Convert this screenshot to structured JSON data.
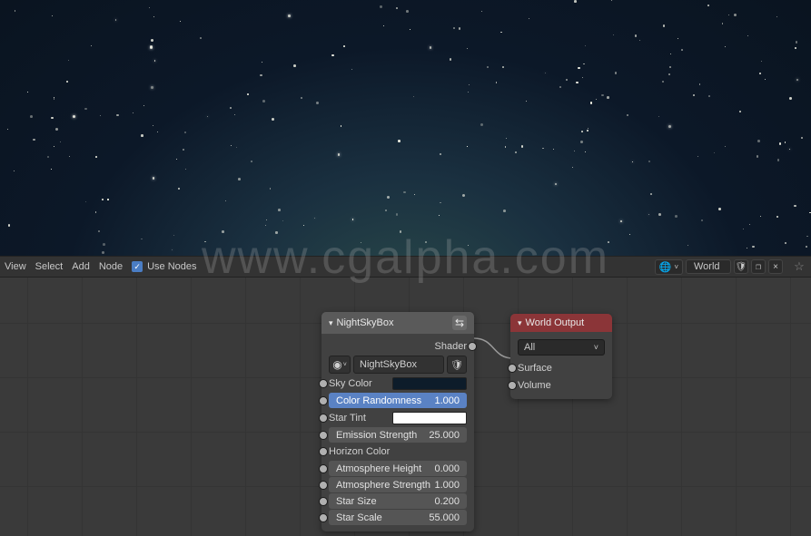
{
  "toolbar": {
    "view": "View",
    "select": "Select",
    "add": "Add",
    "node": "Node",
    "use_nodes_label": "Use Nodes",
    "use_nodes_checked": true,
    "world_name": "World"
  },
  "nodes": {
    "nightsky": {
      "title": "NightSkyBox",
      "shader_out": "Shader",
      "group_name": "NightSkyBox",
      "sky_color_label": "Sky Color",
      "sky_color": "#0d1c2a",
      "color_randomness_label": "Color Randomness",
      "color_randomness_value": "1.000",
      "star_tint_label": "Star Tint",
      "star_tint": "#ffffff",
      "emission_strength_label": "Emission Strength",
      "emission_strength_value": "25.000",
      "horizon_color_label": "Horizon Color",
      "horizon_color": "#0d1c2a",
      "atmosphere_height_label": "Atmosphere Height",
      "atmosphere_height_value": "0.000",
      "atmosphere_strength_label": "Atmosphere Strength",
      "atmosphere_strength_value": "1.000",
      "star_size_label": "Star Size",
      "star_size_value": "0.200",
      "star_scale_label": "Star Scale",
      "star_scale_value": "55.000"
    },
    "world_output": {
      "title": "World Output",
      "target": "All",
      "surface": "Surface",
      "volume": "Volume"
    }
  },
  "watermark": "www.cgalpha.com"
}
